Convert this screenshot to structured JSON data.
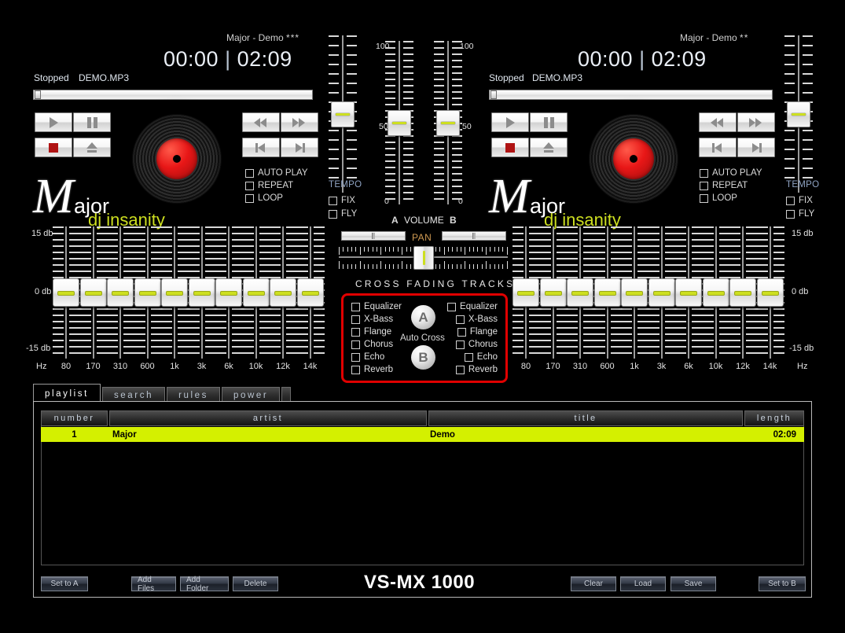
{
  "app": {
    "brand": "VS-MX 1000"
  },
  "decks": [
    {
      "id": "A",
      "track_title": "Major - Demo",
      "stars": "***",
      "elapsed": "00:00",
      "separator": "|",
      "total": "02:09",
      "status": "Stopped",
      "filename": "DEMO.MP3",
      "options": [
        {
          "label": "AUTO PLAY",
          "checked": false
        },
        {
          "label": "REPEAT",
          "checked": false
        },
        {
          "label": "LOOP",
          "checked": false
        }
      ],
      "tempo_label": "TEMPO",
      "tempo_options": [
        {
          "label": "FIX",
          "checked": false
        },
        {
          "label": "FLY",
          "checked": false
        }
      ],
      "transport": [
        {
          "name": "play",
          "icon": "play-icon"
        },
        {
          "name": "pause",
          "icon": "pause-icon"
        },
        {
          "name": "stop",
          "icon": "stop-icon"
        },
        {
          "name": "eject",
          "icon": "eject-icon"
        },
        {
          "name": "rewind",
          "icon": "rewind-icon"
        },
        {
          "name": "fast-forward",
          "icon": "fast-forward-icon"
        },
        {
          "name": "previous",
          "icon": "previous-track-icon"
        },
        {
          "name": "next",
          "icon": "next-track-icon"
        }
      ],
      "logo": {
        "m": "M",
        "rest": "ajor",
        "tagline": "dj insanity"
      }
    },
    {
      "id": "B",
      "track_title": "Major - Demo",
      "stars": "**",
      "elapsed": "00:00",
      "separator": "|",
      "total": "02:09",
      "status": "Stopped",
      "filename": "DEMO.MP3",
      "options": [
        {
          "label": "AUTO PLAY",
          "checked": false
        },
        {
          "label": "REPEAT",
          "checked": false
        },
        {
          "label": "LOOP",
          "checked": false
        }
      ],
      "tempo_label": "TEMPO",
      "tempo_options": [
        {
          "label": "FIX",
          "checked": false
        },
        {
          "label": "FLY",
          "checked": false
        }
      ],
      "logo": {
        "m": "M",
        "rest": "ajor",
        "tagline": "dj insanity"
      }
    }
  ],
  "equalizer": {
    "top_label": "15 db",
    "mid_label": "0 db",
    "bottom_label": "-15 db",
    "hz_label": "Hz",
    "bands": [
      "80",
      "170",
      "310",
      "600",
      "1k",
      "3k",
      "6k",
      "10k",
      "12k",
      "14k"
    ],
    "values": [
      0,
      0,
      0,
      0,
      0,
      0,
      0,
      0,
      0,
      0
    ]
  },
  "center": {
    "volume_label": "VOLUME",
    "volume_a_tag": "A",
    "volume_b_tag": "B",
    "scale_top": "100",
    "scale_mid": "50",
    "scale_bottom": "0",
    "volume_a_value": 50,
    "volume_b_value": 50,
    "pan_label": "PAN",
    "pan_a_value": 50,
    "pan_b_value": 50,
    "crossfader_value": 50,
    "cross_title": "CROSS FADING TRACKS",
    "auto_cross_label": "Auto Cross",
    "deck_a_ball": "A",
    "deck_b_ball": "B",
    "effects_a": [
      {
        "label": "Equalizer",
        "checked": false
      },
      {
        "label": "X-Bass",
        "checked": false
      },
      {
        "label": "Flange",
        "checked": false
      },
      {
        "label": "Chorus",
        "checked": false
      },
      {
        "label": "Echo",
        "checked": false
      },
      {
        "label": "Reverb",
        "checked": false
      }
    ],
    "effects_b": [
      {
        "label": "Equalizer",
        "checked": false
      },
      {
        "label": "X-Bass",
        "checked": false
      },
      {
        "label": "Flange",
        "checked": false
      },
      {
        "label": "Chorus",
        "checked": false
      },
      {
        "label": "Echo",
        "checked": false
      },
      {
        "label": "Reverb",
        "checked": false
      }
    ],
    "border_color": "#e00000"
  },
  "playlist": {
    "tabs": [
      {
        "label": "playlist",
        "active": true
      },
      {
        "label": "search",
        "active": false
      },
      {
        "label": "rules",
        "active": false
      },
      {
        "label": "power",
        "active": false
      }
    ],
    "columns": [
      "number",
      "artist",
      "title",
      "length"
    ],
    "rows": [
      {
        "number": "1",
        "artist": "Major",
        "title": "Demo",
        "length": "02:09",
        "selected": true
      }
    ],
    "left_buttons": [
      "Set to A"
    ],
    "mid_buttons": [
      "Add Files",
      "Add Folder",
      "Delete"
    ],
    "right_buttons": [
      "Clear",
      "Load",
      "Save"
    ],
    "far_right_buttons": [
      "Set to B"
    ],
    "highlight_color": "#d4f000"
  }
}
